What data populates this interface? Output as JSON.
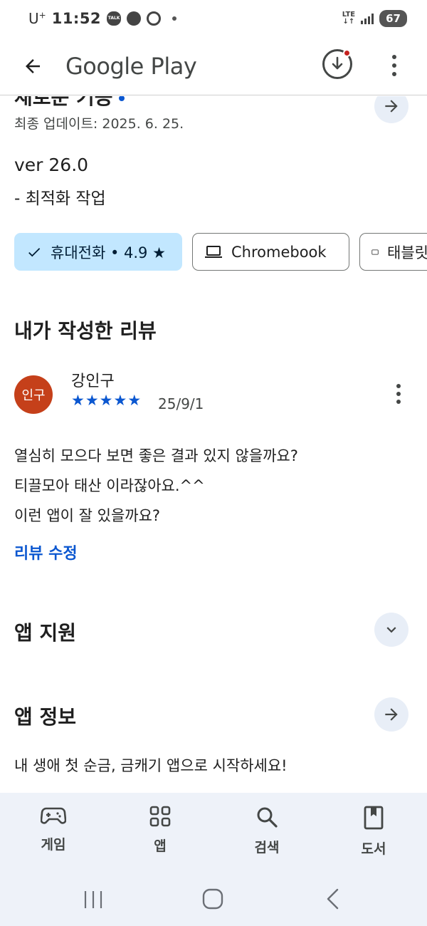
{
  "status_bar": {
    "carrier": "U",
    "carrier_sup": "+",
    "time": "11:52",
    "talk_badge": "TALK",
    "network": "LTE",
    "battery": "67"
  },
  "app_bar": {
    "title": "Google Play"
  },
  "whats_new": {
    "heading_clipped": "새로운 기능",
    "last_updated": "최종 업데이트: 2025. 6. 25.",
    "version": "ver 26.0",
    "note": "- 최적화 작업"
  },
  "device_chips": [
    {
      "label": "휴대전화 • 4.9 ★",
      "icon": "check-icon",
      "selected": true
    },
    {
      "label": "Chromebook",
      "icon": "laptop-icon",
      "selected": false
    },
    {
      "label": "태블릿",
      "icon": "tablet-icon",
      "selected": false
    }
  ],
  "my_review": {
    "title": "내가 작성한 리뷰",
    "avatar_text": "인구",
    "avatar_color": "#c5401a",
    "reviewer": "강인구",
    "rating": 5,
    "stars": "★★★★★",
    "date": "25/9/1",
    "lines": [
      "열심히 모으다 보면 좋은 결과 있지 않을까요?",
      "티끌모아 태산 이라잖아요.^^",
      "이런 앱이 잘 있을까요?"
    ],
    "edit_label": "리뷰 수정"
  },
  "app_support": {
    "title": "앱 지원"
  },
  "app_info": {
    "title": "앱 정보",
    "description": "내 생애 첫 순금, 금캐기 앱으로 시작하세요!"
  },
  "bottom_nav": [
    {
      "label": "게임",
      "icon": "gamepad-icon"
    },
    {
      "label": "앱",
      "icon": "apps-grid-icon"
    },
    {
      "label": "검색",
      "icon": "search-icon"
    },
    {
      "label": "도서",
      "icon": "book-icon"
    }
  ],
  "colors": {
    "accent": "#0b57d0",
    "chip_selected": "#c2e7ff",
    "nav_background": "#eef2f9",
    "notification_dot": "#c5221f"
  }
}
